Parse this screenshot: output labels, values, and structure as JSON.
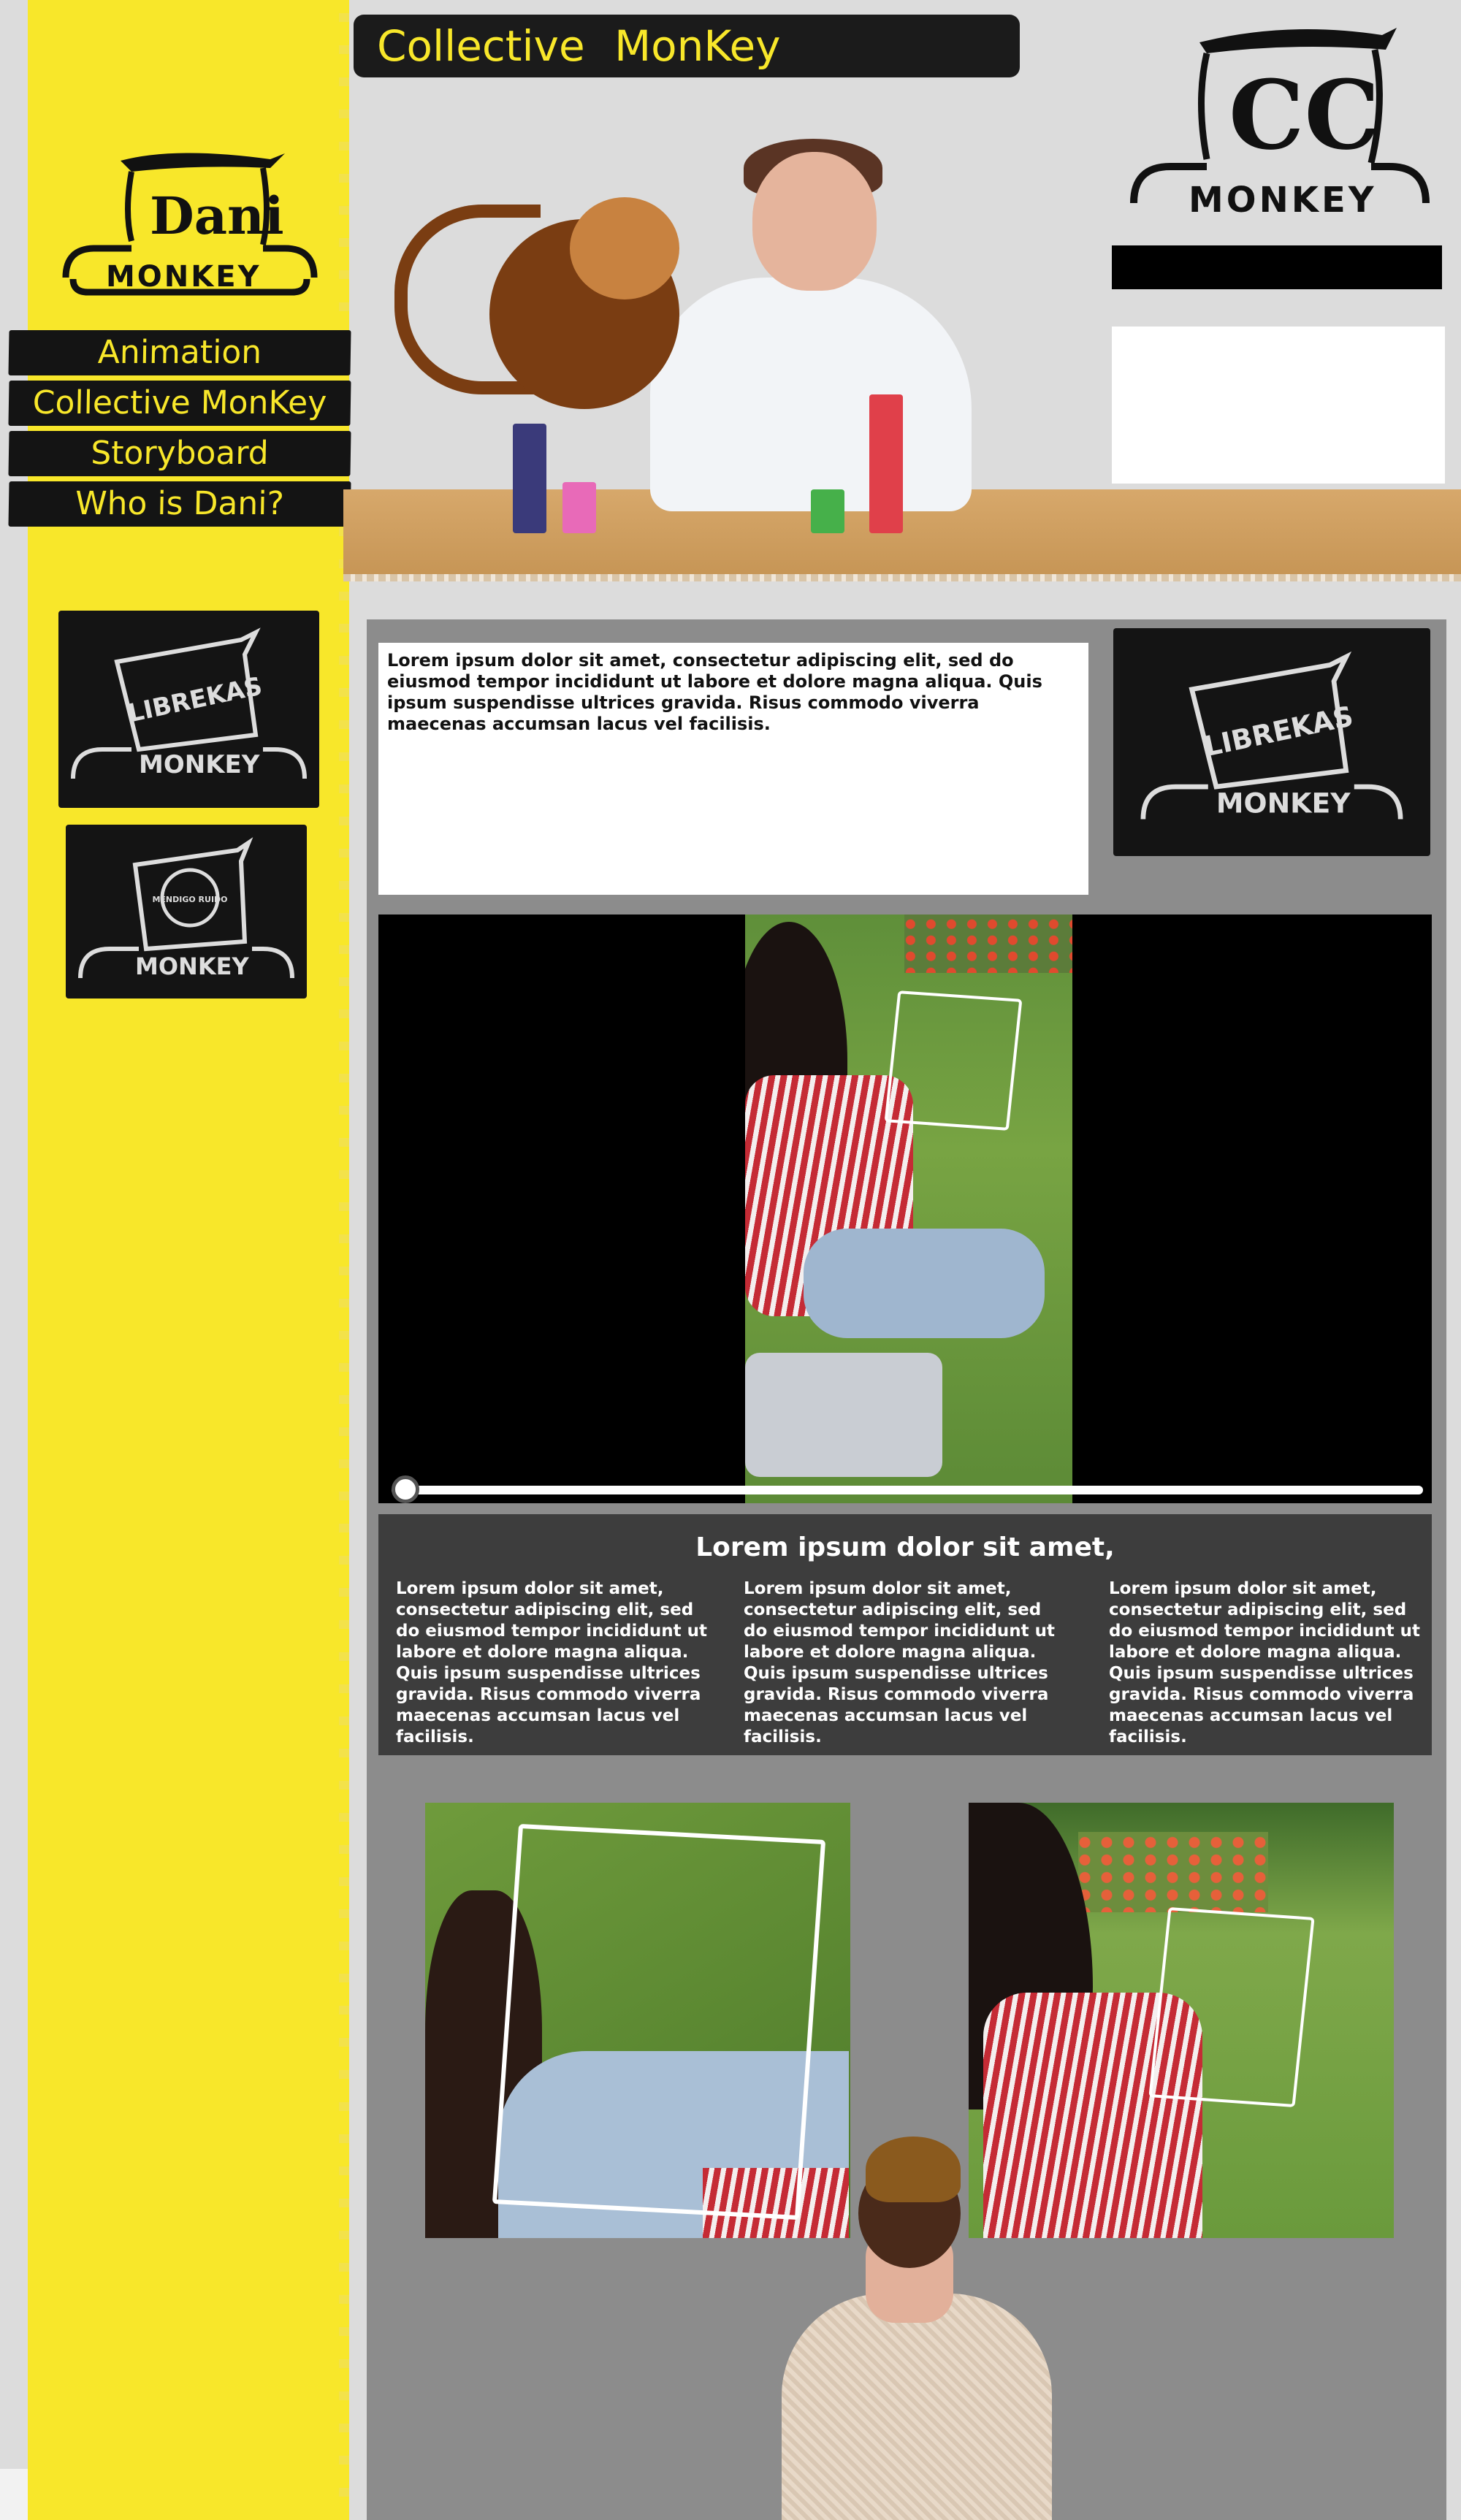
{
  "site": {
    "title": "Collective MonKey",
    "brand_logo_text_top": "Dani",
    "brand_logo_text_bottom": "MONKEY",
    "cc_logo_text": "MONKEY"
  },
  "nav": {
    "items": [
      {
        "label": "Animation"
      },
      {
        "label": "Collective MonKey"
      },
      {
        "label": "Storyboard"
      },
      {
        "label": "Who is Dani?"
      }
    ]
  },
  "clients": {
    "librekas": {
      "line1": "LIBREKAS",
      "line2": "MONKEY"
    },
    "mendigo": {
      "line1": "MENDIGO RUIDO",
      "line2": "MONKEY"
    }
  },
  "intro": {
    "text": "Lorem ipsum dolor sit amet, consectetur adipiscing elit, sed do eiusmod tempor incididunt ut labore et dolore magna aliqua. Quis ipsum suspendisse ultrices gravida. Risus commodo viverra maecenas accumsan lacus vel facilisis."
  },
  "video": {
    "progress": 0.0
  },
  "columns": {
    "heading": "Lorem ipsum dolor sit amet,",
    "items": [
      {
        "text": "Lorem ipsum dolor sit amet, consectetur adipiscing elit, sed do eiusmod tempor incididunt ut labore et dolore magna aliqua. Quis ipsum suspendisse ultrices gravida. Risus commodo viverra maecenas accumsan lacus vel facilisis."
      },
      {
        "text": "Lorem ipsum dolor sit amet, consectetur adipiscing elit, sed do eiusmod tempor incididunt ut labore et dolore magna aliqua. Quis ipsum suspendisse ultrices gravida. Risus commodo viverra maecenas accumsan lacus vel facilisis."
      },
      {
        "text": "Lorem ipsum dolor sit amet, consectetur adipiscing elit, sed do eiusmod tempor incididunt ut labore et dolore magna aliqua. Quis ipsum suspendisse ultrices gravida. Risus commodo viverra maecenas accumsan lacus vel facilisis."
      }
    ]
  },
  "colors": {
    "sidebar_yellow": "#f8e72a",
    "nav_black": "#141414",
    "main_gray": "#8c8c8c",
    "columns_dark": "#3d3d3d"
  }
}
